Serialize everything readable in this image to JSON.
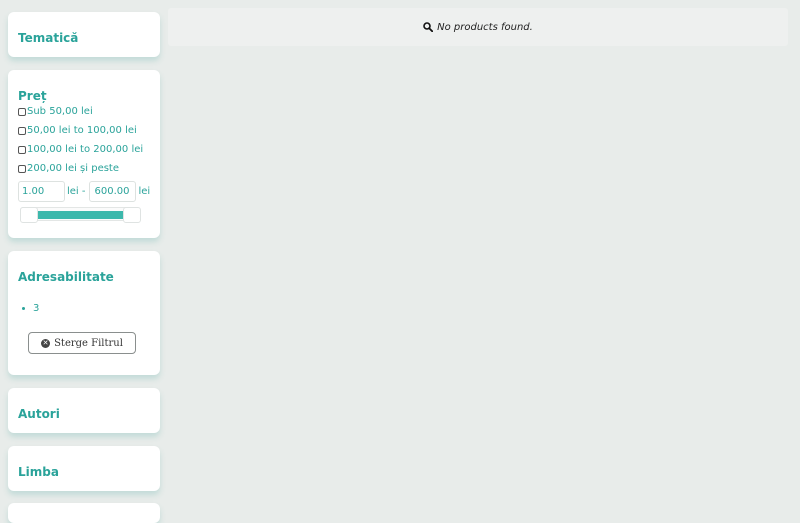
{
  "filters": {
    "tematica": {
      "title": "Tematică"
    },
    "pret": {
      "title": "Preț",
      "options": [
        "Sub 50,00 lei",
        "50,00 lei to 100,00 lei",
        "100,00 lei to 200,00 lei",
        "200,00 lei și peste"
      ],
      "range": {
        "min_value": "1.00",
        "max_value": "600.00",
        "currency": "lei",
        "separator": "lei -"
      }
    },
    "adresabilitate": {
      "title": "Adresabilitate",
      "selected": [
        "3"
      ],
      "clear_label": "Sterge Filtrul"
    },
    "autori": {
      "title": "Autori"
    },
    "limba": {
      "title": "Limba"
    }
  },
  "results": {
    "empty_message": "No products found."
  },
  "colors": {
    "accent": "#2aa39a",
    "slider_fill": "#3cb8ac",
    "background": "#e8ecea"
  }
}
